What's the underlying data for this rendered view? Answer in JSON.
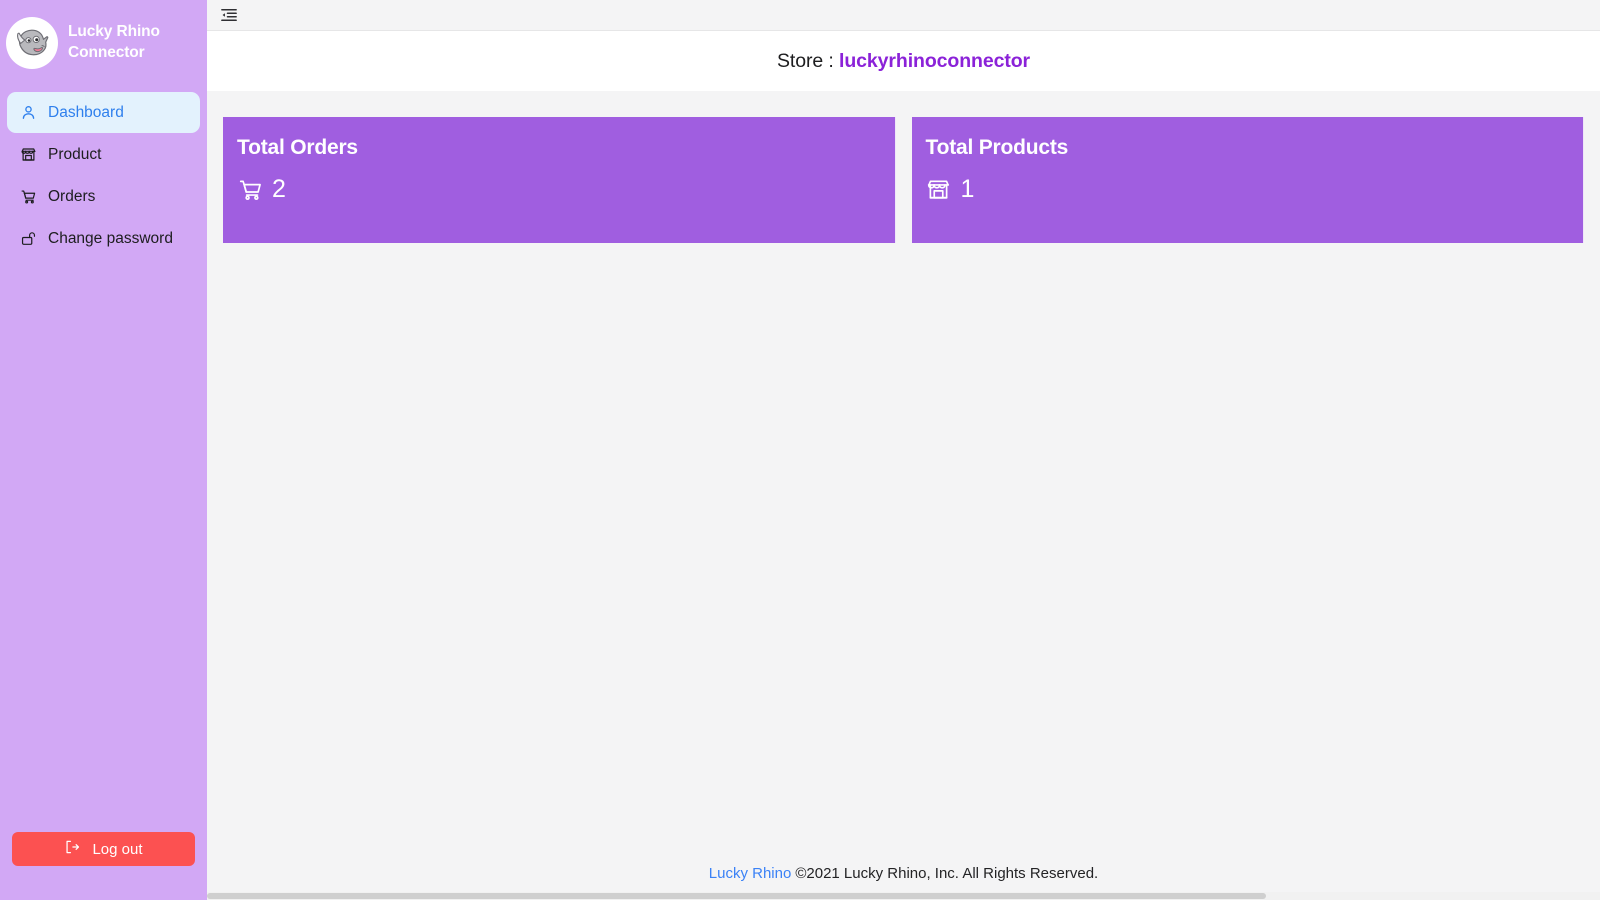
{
  "sidebar": {
    "brand": {
      "logo_icon": "rhino-logo-icon",
      "name_line1": "Lucky Rhino",
      "name_line2": "Connector",
      "name_full": "Lucky Rhino Connector"
    },
    "items": [
      {
        "label": "Dashboard",
        "icon": "user-icon",
        "active": true
      },
      {
        "label": "Product",
        "icon": "storefront-icon",
        "active": false
      },
      {
        "label": "Orders",
        "icon": "shopping-cart-icon",
        "active": false
      },
      {
        "label": "Change password",
        "icon": "unlock-padlock-icon",
        "active": false
      }
    ],
    "logout": {
      "label": "Log out",
      "icon": "logout-icon"
    }
  },
  "topbar": {
    "menu_toggle_icon": "menu-collapse-icon"
  },
  "banner": {
    "prefix": "Store :",
    "store_name": "luckyrhinoconnector"
  },
  "cards": [
    {
      "title": "Total Orders",
      "value": "2",
      "icon": "shopping-cart-icon"
    },
    {
      "title": "Total Products",
      "value": "1",
      "icon": "storefront-icon"
    }
  ],
  "footer": {
    "link_label": "Lucky Rhino",
    "copyright": "©2021 Lucky Rhino, Inc. All Rights Reserved."
  },
  "colors": {
    "sidebar_bg": "#d2a8f5",
    "card_bg": "#a05ee0",
    "accent_purple": "#8b22d8",
    "active_item_bg": "#e3f2fd",
    "active_item_text": "#2f80ed",
    "logout_red": "#fc5151",
    "footer_link_blue": "#3b82f6",
    "content_bg": "#f4f4f5"
  }
}
